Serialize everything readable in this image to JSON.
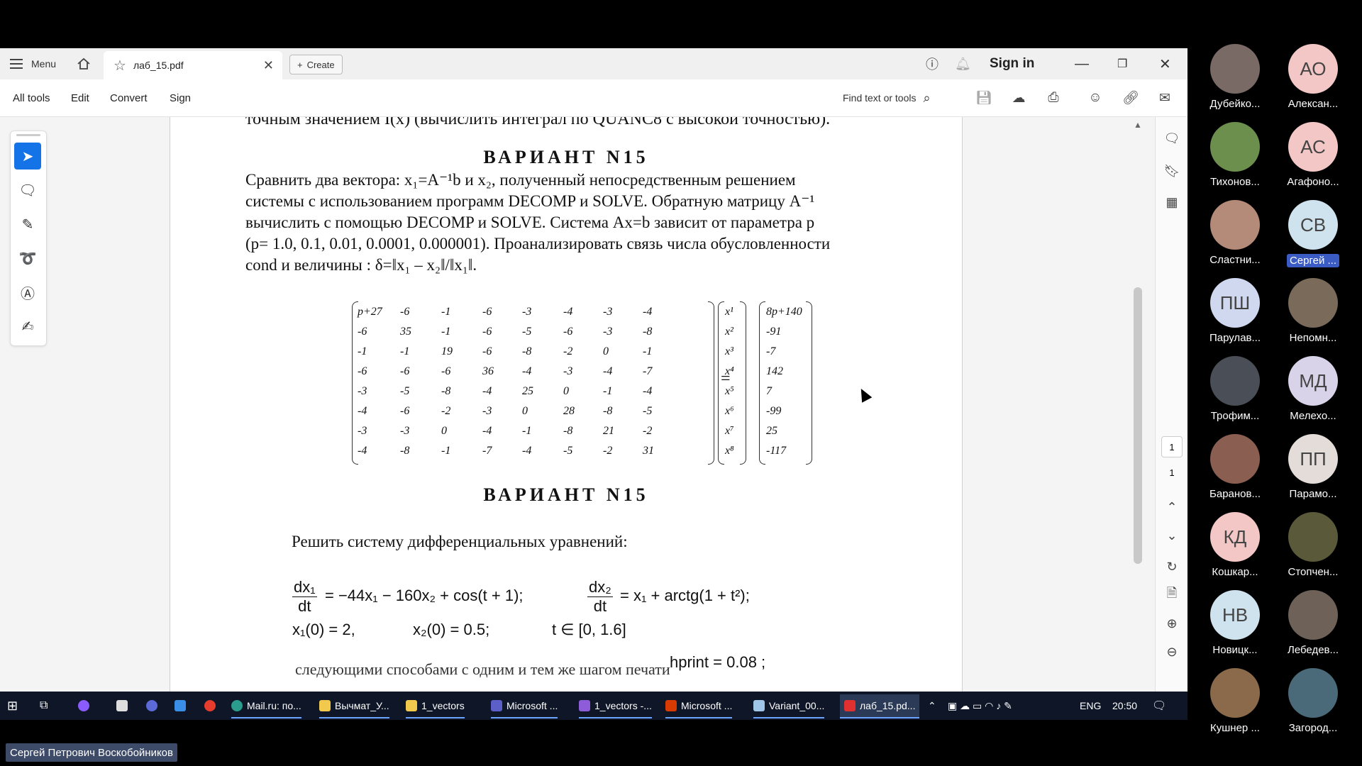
{
  "acrobat": {
    "menu_label": "Menu",
    "tab_title": "лаб_15.pdf",
    "create_label": "Create",
    "sign_in": "Sign in",
    "toolbar": {
      "all_tools": "All tools",
      "edit": "Edit",
      "convert": "Convert",
      "sign": "Sign",
      "find": "Find text or tools"
    },
    "page_current": "1",
    "page_total": "1"
  },
  "document": {
    "cut_line": "точным значением I(x) (вычислить интеграл по QUANC8 с высокой точностью).",
    "variant_title": "ВАРИАНТ   N15",
    "para1_lines": [
      "Сравнить два вектора: x₁=A⁻¹b и x₂, полученный непосредственным решением",
      "системы с использованием программ DECOMP и SOLVE. Обратную матрицу A⁻¹",
      "вычислить с помощью DECOMP и SOLVE. Система Ax=b зависит от параметра p",
      "(p= 1.0, 0.1, 0.01, 0.0001, 0.000001). Проанализировать связь числа обусловленности",
      "cond  и величины  : δ=‖x₁ – x₂‖/‖x₁‖."
    ],
    "matrix": [
      [
        "p+27",
        "-6",
        "-1",
        "-6",
        "-3",
        "-4",
        "-3",
        "-4"
      ],
      [
        "-6",
        "35",
        "-1",
        "-6",
        "-5",
        "-6",
        "-3",
        "-8"
      ],
      [
        "-1",
        "-1",
        "19",
        "-6",
        "-8",
        "-2",
        "0",
        "-1"
      ],
      [
        "-6",
        "-6",
        "-6",
        "36",
        "-4",
        "-3",
        "-4",
        "-7"
      ],
      [
        "-3",
        "-5",
        "-8",
        "-4",
        "25",
        "0",
        "-1",
        "-4"
      ],
      [
        "-4",
        "-6",
        "-2",
        "-3",
        "0",
        "28",
        "-8",
        "-5"
      ],
      [
        "-3",
        "-3",
        "0",
        "-4",
        "-1",
        "-8",
        "21",
        "-2"
      ],
      [
        "-4",
        "-8",
        "-1",
        "-7",
        "-4",
        "-5",
        "-2",
        "31"
      ]
    ],
    "x_vector": [
      "x¹",
      "x²",
      "x³",
      "x⁴",
      "x⁵",
      "x⁶",
      "x⁷",
      "x⁸"
    ],
    "rhs": [
      "8p+140",
      "-91",
      "-7",
      "142",
      "7",
      "-99",
      "25",
      "-117"
    ],
    "equals": "=",
    "variant_title_2": "ВАРИАНТ   N15",
    "ode_intro": "Решить систему дифференциальных уравнений:",
    "ode": {
      "dx1": "dx₁",
      "dt": "dt",
      "eq1_rhs": "= −44x₁ − 160x₂ + cos(t + 1);",
      "dx2": "dx₂",
      "eq2_rhs": "= x₁ + arctg(1 + t²);",
      "init1": "x₁(0) = 2,",
      "init2": "x₂(0) = 0.5;",
      "t_range": "t ∈ [0,  1.6]",
      "hprint": "hprint = 0.08  ;",
      "bottom_cut": "следующими способами с одним и тем же шагом печати"
    }
  },
  "taskbar": {
    "items": [
      "Mail.ru: по...",
      "Вычмат_У...",
      "1_vectors",
      "Microsoft ...",
      "1_vectors -...",
      "Microsoft ...",
      "Variant_00...",
      "лаб_15.pd..."
    ],
    "lang": "ENG",
    "time": "20:50"
  },
  "participants": [
    {
      "name": "Дубейко...",
      "initials": "",
      "color": "#7a6a66"
    },
    {
      "name": "Алексан...",
      "initials": "АО",
      "color": "#f4c7c7"
    },
    {
      "name": "Тихонов...",
      "initials": "",
      "color": "#6c8f4e"
    },
    {
      "name": "Агафоно...",
      "initials": "АС",
      "color": "#f4c7c7"
    },
    {
      "name": "Сластни...",
      "initials": "",
      "color": "#b48a78"
    },
    {
      "name": "Сергей ...",
      "initials": "СВ",
      "color": "#cfe3ee"
    },
    {
      "name": "Парулав...",
      "initials": "ПШ",
      "color": "#cfd8ee"
    },
    {
      "name": "Непомн...",
      "initials": "",
      "color": "#7a6a5a"
    },
    {
      "name": "Трофим...",
      "initials": "",
      "color": "#4a4e56"
    },
    {
      "name": "Мелехо...",
      "initials": "МД",
      "color": "#d9d3ea"
    },
    {
      "name": "Баранов...",
      "initials": "",
      "color": "#8a5e50"
    },
    {
      "name": "Парамо...",
      "initials": "ПП",
      "color": "#e4dcd8"
    },
    {
      "name": "Кошкар...",
      "initials": "КД",
      "color": "#f4c7c7"
    },
    {
      "name": "Стопчен...",
      "initials": "",
      "color": "#5a5a3a"
    },
    {
      "name": "Новицк...",
      "initials": "НВ",
      "color": "#cfe3ee"
    },
    {
      "name": "Лебедев...",
      "initials": "",
      "color": "#6e6258"
    },
    {
      "name": "Кушнер ...",
      "initials": "",
      "color": "#8a6a4a"
    },
    {
      "name": "Загород...",
      "initials": "",
      "color": "#4a6a7a"
    }
  ],
  "speaker_name": "Сергей Петрович Воскобойников"
}
